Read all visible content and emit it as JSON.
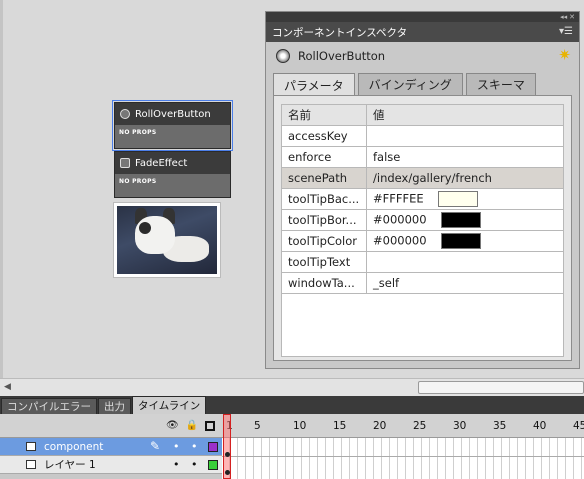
{
  "stage": {
    "components": [
      {
        "title": "RollOverButton",
        "props": "NO PROPS"
      },
      {
        "title": "FadeEffect",
        "props": "NO PROPS"
      }
    ]
  },
  "inspector": {
    "panel_title": "コンポーネントインスペクタ",
    "component_name": "RollOverButton",
    "tabs": [
      "パラメータ",
      "バインディング",
      "スキーマ"
    ],
    "columns": [
      "名前",
      "値"
    ],
    "rows": [
      {
        "name": "accessKey",
        "value": ""
      },
      {
        "name": "enforce",
        "value": "false"
      },
      {
        "name": "scenePath",
        "value": "/index/gallery/french"
      },
      {
        "name": "toolTipBac...",
        "value": "#FFFFEE",
        "swatch": "#ffffee"
      },
      {
        "name": "toolTipBor...",
        "value": "#000000",
        "swatch": "#000000"
      },
      {
        "name": "toolTipColor",
        "value": "#000000",
        "swatch": "#000000"
      },
      {
        "name": "toolTipText",
        "value": ""
      },
      {
        "name": "windowTa...",
        "value": "_self"
      }
    ]
  },
  "bottom_tabs": [
    "コンパイルエラー",
    "出力",
    "タイムライン"
  ],
  "timeline": {
    "ruler": [
      "1",
      "5",
      "10",
      "15",
      "20",
      "25",
      "30",
      "35",
      "40",
      "45"
    ],
    "layers": [
      {
        "name": "component",
        "color": "#9b30c8"
      },
      {
        "name": "レイヤー 1",
        "color": "#3ad03a"
      }
    ]
  }
}
